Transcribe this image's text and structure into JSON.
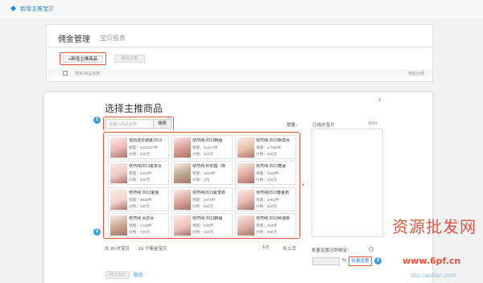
{
  "breadcrumb": {
    "title": "新增主推宝贝"
  },
  "background": {
    "tabs": [
      "佣金管理",
      "宝贝报表"
    ],
    "add_button": "+新增主推商品",
    "second_button": "删除主推",
    "col_item": "类目/商品名称",
    "col_rate": "佣金比例"
  },
  "modal": {
    "title": "选择主推商品",
    "close": "×",
    "search_placeholder": "请输入商品名称",
    "search_button": "搜索",
    "sort_label": "销量↓",
    "selected_title": "已选中宝贝",
    "selected_count_value": "0",
    "selected_count_total": "/84",
    "arrow": "›",
    "steps": [
      "1",
      "2",
      "3"
    ],
    "products": [
      {
        "title": "雪纺连衣裙夏2013",
        "sales": "销量：1011627件",
        "price": "价格：330元"
      },
      {
        "title": "依然纯 2013韩版",
        "sales": "销量：52317件",
        "price": "价格：320元"
      },
      {
        "title": "依然纯 2013新款女",
        "sales": "销量：17093件",
        "price": "价格：330元"
      },
      {
        "title": "依然纯2013夏季女",
        "sales": "销量：8414件",
        "price": "价格：330元"
      },
      {
        "title": "依然纯 针织露（新",
        "sales": "销量：4514件",
        "price": "价格：1元"
      },
      {
        "title": "依然纯 2013春夏",
        "sales": "销量：4109件",
        "price": "价格：320元"
      },
      {
        "title": "依然纯 2013夏装",
        "sales": "销量：3848件",
        "price": "价格：330元"
      },
      {
        "title": "依然纯2013夏季新",
        "sales": "销量：2975件",
        "price": "价格：330元"
      },
      {
        "title": "依然纯2013春夏新",
        "sales": "销量：2852件",
        "price": "价格：310元"
      },
      {
        "title": "依然纯 风衣女",
        "sales": "销量：1415件",
        "price": "价格：730元"
      },
      {
        "title": "依然纯 2013韩版",
        "sales": "销量：942件",
        "price": "价格：320元"
      },
      {
        "title": "依然纯 2013秋装新",
        "sales": "销量：234件",
        "price": "价格：690元"
      }
    ],
    "footer_total": "共 26 件宝贝　　16 个佣金宝贝",
    "page_info": "1/3",
    "page_total": "共 3 页",
    "batch_label": "批量设置比例佣金：",
    "batch_pct": "%",
    "batch_button": "批量设置",
    "confirm_button": "确定添加",
    "cancel_link": "取消"
  },
  "watermark": {
    "text": "资源批发网",
    "url": "www.6pf.cn",
    "domain": "bbs.taobao.com"
  }
}
